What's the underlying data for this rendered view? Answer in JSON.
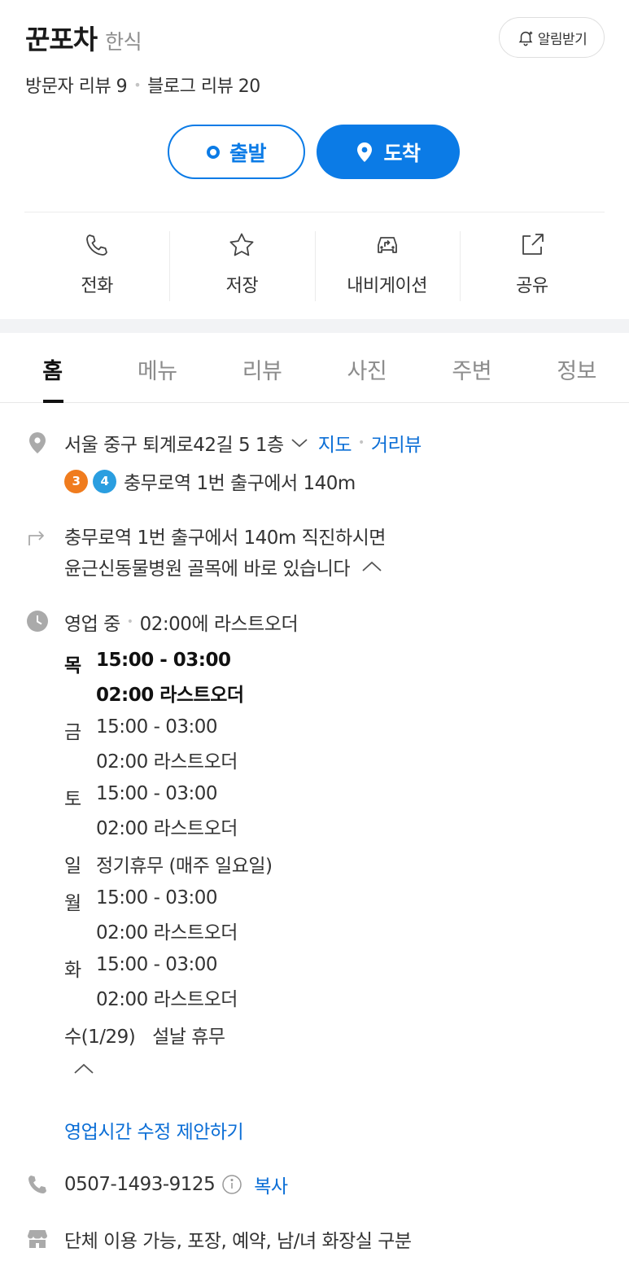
{
  "header": {
    "name": "꾼포차",
    "category": "한식",
    "alarm_label": "알림받기",
    "visitor_review": "방문자 리뷰 9",
    "blog_review": "블로그 리뷰 20"
  },
  "route": {
    "start_label": "출발",
    "end_label": "도착",
    "accent": "#0b7be6"
  },
  "actions": [
    {
      "label": "전화",
      "icon": "phone-icon"
    },
    {
      "label": "저장",
      "icon": "star-icon"
    },
    {
      "label": "내비게이션",
      "icon": "car-navigation-icon"
    },
    {
      "label": "공유",
      "icon": "share-icon"
    }
  ],
  "tabs": [
    {
      "label": "홈",
      "active": true
    },
    {
      "label": "메뉴"
    },
    {
      "label": "리뷰"
    },
    {
      "label": "사진"
    },
    {
      "label": "주변"
    },
    {
      "label": "정보"
    }
  ],
  "info": {
    "address": "서울 중구 퇴계로42길 5 1층",
    "map_link": "지도",
    "street_view_link": "거리뷰",
    "subway_lines": [
      "3",
      "4"
    ],
    "subway_text": "충무로역 1번 출구에서 140m",
    "directions_line1": "충무로역 1번 출구에서 140m 직진하시면",
    "directions_line2": "윤근신동물병원 골목에 바로 있습니다",
    "status": "영업 중",
    "last_order": "02:00에 라스트오더",
    "hours": [
      {
        "day": "목",
        "time": "15:00 - 03:00",
        "note": "02:00 라스트오더"
      },
      {
        "day": "금",
        "time": "15:00 - 03:00",
        "note": "02:00 라스트오더"
      },
      {
        "day": "토",
        "time": "15:00 - 03:00",
        "note": "02:00 라스트오더"
      },
      {
        "day": "일",
        "time": "정기휴무 (매주 일요일)"
      },
      {
        "day": "월",
        "time": "15:00 - 03:00",
        "note": "02:00 라스트오더"
      },
      {
        "day": "화",
        "time": "15:00 - 03:00",
        "note": "02:00 라스트오더"
      },
      {
        "day": "수(1/29)",
        "time": "설날 휴무"
      }
    ],
    "suggest_edit": "영업시간 수정 제안하기",
    "phone": "0507-1493-9125",
    "copy_label": "복사",
    "facilities": "단체 이용 가능, 포장, 예약, 남/녀 화장실 구분"
  }
}
